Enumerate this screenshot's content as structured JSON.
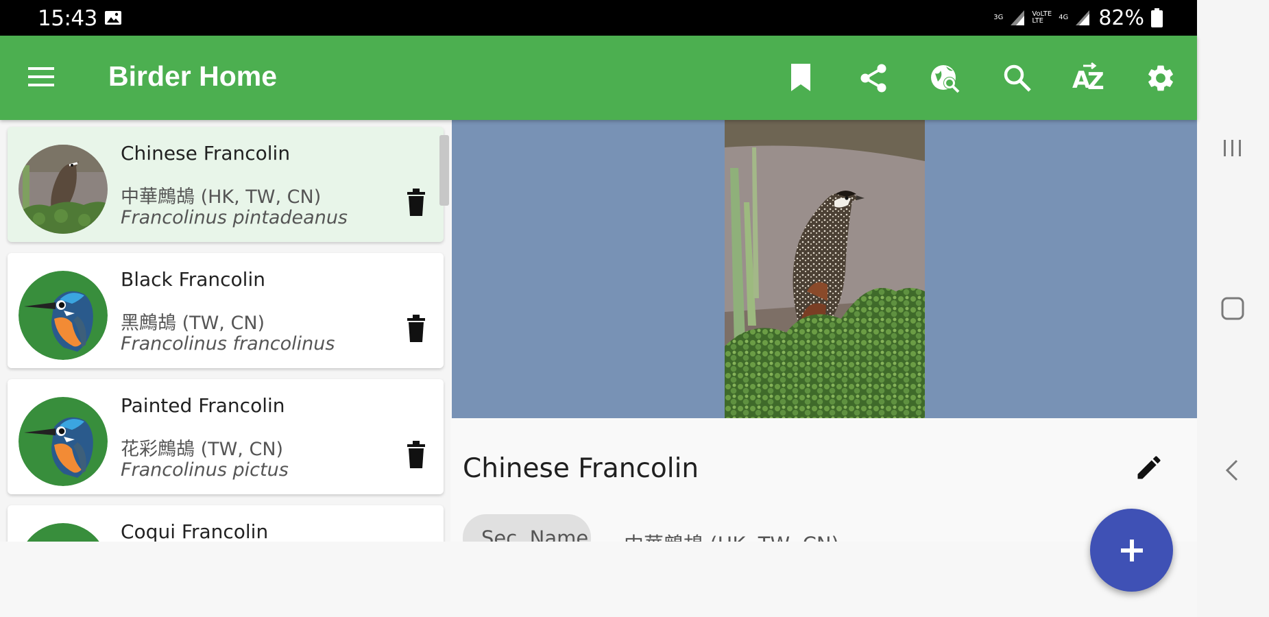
{
  "status_bar": {
    "time": "15:43",
    "network_1": "3G",
    "network_2_line1": "VoLTE",
    "network_2_line2": "LTE",
    "network_3": "4G",
    "battery": "82%"
  },
  "app_bar": {
    "title": "Birder Home",
    "color": "#4caf50",
    "actions": [
      "bookmark-icon",
      "share-icon",
      "web-search-icon",
      "search-icon",
      "sort-az-icon",
      "settings-icon"
    ]
  },
  "bird_list": [
    {
      "name": "Chinese Francolin",
      "local": "中華鷓鴣 (HK, TW, CN)",
      "scientific": "Francolinus pintadeanus",
      "selected": true,
      "avatar": "bird-photo"
    },
    {
      "name": "Black Francolin",
      "local": "黑鷓鴣 (TW, CN)",
      "scientific": "Francolinus francolinus",
      "selected": false,
      "avatar": "kingfisher-icon"
    },
    {
      "name": "Painted Francolin",
      "local": "花彩鷓鴣 (TW, CN)",
      "scientific": "Francolinus pictus",
      "selected": false,
      "avatar": "kingfisher-icon"
    },
    {
      "name": "Coqui Francolin",
      "local": "",
      "scientific": "",
      "selected": false,
      "avatar": "kingfisher-icon"
    }
  ],
  "detail": {
    "title": "Chinese Francolin",
    "sec_name_label": "Sec. Name",
    "sec_name_value": "中華鷓鴣 (HK, TW, CN)",
    "photo_background": "#7892b5"
  },
  "fab": {
    "symbol": "+",
    "color": "#3f51b5"
  },
  "nav_bar": [
    "recent-apps-icon",
    "home-icon",
    "back-icon"
  ]
}
